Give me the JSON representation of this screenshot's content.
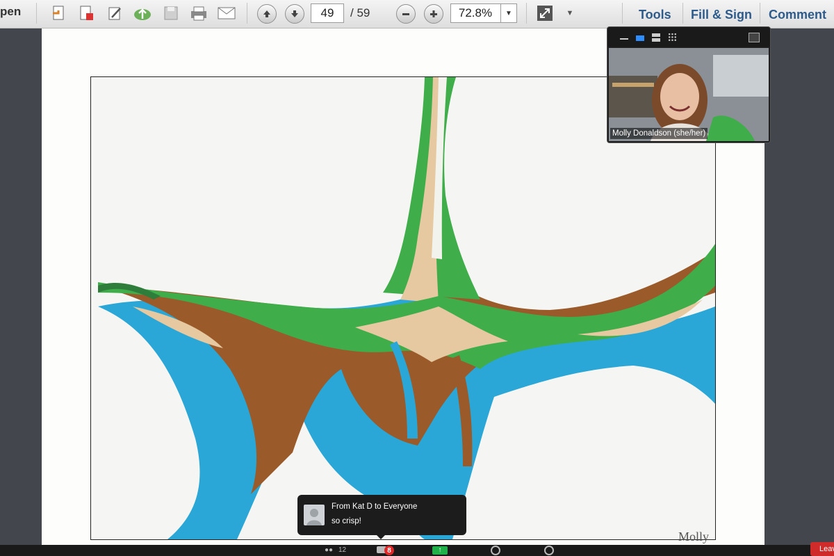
{
  "toolbar": {
    "open_label": "pen",
    "page_current": "49",
    "page_total": "/ 59",
    "zoom": "72.8%",
    "menu": [
      "Tools",
      "Fill & Sign",
      "Comment"
    ]
  },
  "icons": [
    "open-file-icon",
    "create-pdf-icon",
    "edit-icon",
    "upload-icon",
    "save-icon",
    "print-icon",
    "email-icon",
    "prev-page-icon",
    "next-page-icon",
    "zoom-out-icon",
    "zoom-in-icon",
    "fullscreen-icon",
    "more-icon"
  ],
  "video": {
    "participant": "Molly Donaldson (she/her)"
  },
  "chat": {
    "from": "From Kat D to Everyone",
    "message": "so crisp!"
  },
  "document": {
    "signature": "Molly"
  },
  "bottombar": {
    "participants_count": "12",
    "chat_badge": "8",
    "leave_label": "Leav"
  },
  "colors": {
    "menu_link": "#2d5b8c",
    "marble_green": "#3fae4a",
    "marble_blue": "#2aa7d6",
    "marble_brown": "#9a5a2a",
    "marble_tan": "#e6c9a0",
    "leave_red": "#cf2b2b"
  }
}
